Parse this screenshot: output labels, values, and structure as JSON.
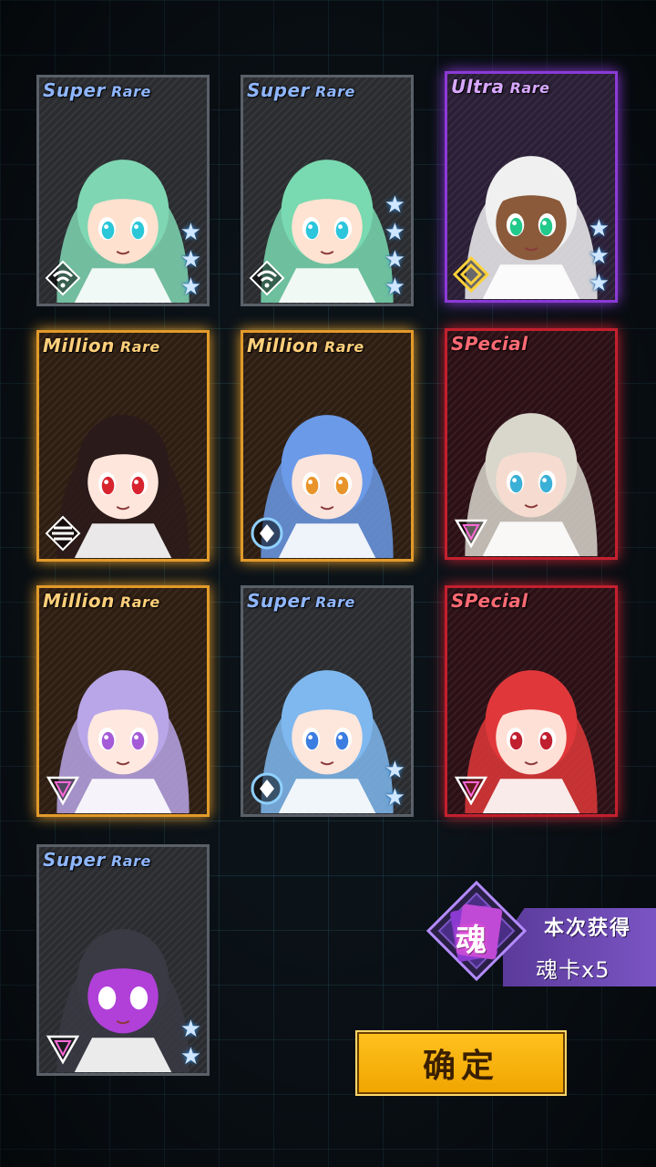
{
  "cards": [
    {
      "rarity": "Super",
      "rarity2": "Rare",
      "class": "r-super",
      "stars": 3,
      "emblem": "wifi-emblem-icon",
      "hair": "#7fd6b3",
      "skin": "#ffe1cf",
      "eye": "#29c7d8"
    },
    {
      "rarity": "Super",
      "rarity2": "Rare",
      "class": "r-super",
      "stars": 4,
      "emblem": "wifi-emblem-icon",
      "hair": "#79d9b0",
      "skin": "#ffe3d2",
      "eye": "#2bc6dc"
    },
    {
      "rarity": "Ultra",
      "rarity2": "Rare",
      "class": "r-ultra",
      "stars": 3,
      "emblem": "diamond-emblem-icon",
      "hair": "#f0f0f0",
      "skin": "#8a5a3a",
      "eye": "#21c98a"
    },
    {
      "rarity": "Million",
      "rarity2": "Rare",
      "class": "r-million",
      "stars": 0,
      "emblem": "stripes-emblem-icon",
      "hair": "#2a1a1a",
      "skin": "#ffe6dc",
      "eye": "#d8242f"
    },
    {
      "rarity": "Million",
      "rarity2": "Rare",
      "class": "r-million",
      "stars": 0,
      "emblem": "ring-emblem-icon",
      "hair": "#6a9ae8",
      "skin": "#fbe4dc",
      "eye": "#e9942a"
    },
    {
      "rarity": "SPecial",
      "rarity2": "",
      "class": "r-special",
      "stars": 0,
      "emblem": "triangle-emblem-icon",
      "hair": "#d9d6cc",
      "skin": "#f6dcd0",
      "eye": "#3ab0d6"
    },
    {
      "rarity": "Million",
      "rarity2": "Rare",
      "class": "r-million",
      "stars": 0,
      "emblem": "triangle-emblem-icon",
      "hair": "#b8a6e8",
      "skin": "#ffe8e0",
      "eye": "#a55bd8"
    },
    {
      "rarity": "Super",
      "rarity2": "Rare",
      "class": "r-super",
      "stars": 2,
      "emblem": "ring-emblem-icon",
      "hair": "#7fb8ef",
      "skin": "#fde6dc",
      "eye": "#3b7de0"
    },
    {
      "rarity": "SPecial",
      "rarity2": "",
      "class": "r-special",
      "stars": 0,
      "emblem": "triangle-emblem-icon",
      "hair": "#e0383a",
      "skin": "#ffe0d6",
      "eye": "#c02030"
    },
    {
      "rarity": "Super",
      "rarity2": "Rare",
      "class": "r-super",
      "stars": 2,
      "emblem": "triangle-emblem-icon",
      "hair": "#3a3a44",
      "skin": "#b040d8",
      "eye": "#ffffff"
    }
  ],
  "reward": {
    "title": "本次获得",
    "soul_char": "魂",
    "count_text": "魂卡x5"
  },
  "confirm_label": "确定",
  "colors": {
    "accent": "#ffc21f",
    "grid": "#3c8ca0",
    "panel": "#6a48b4"
  }
}
